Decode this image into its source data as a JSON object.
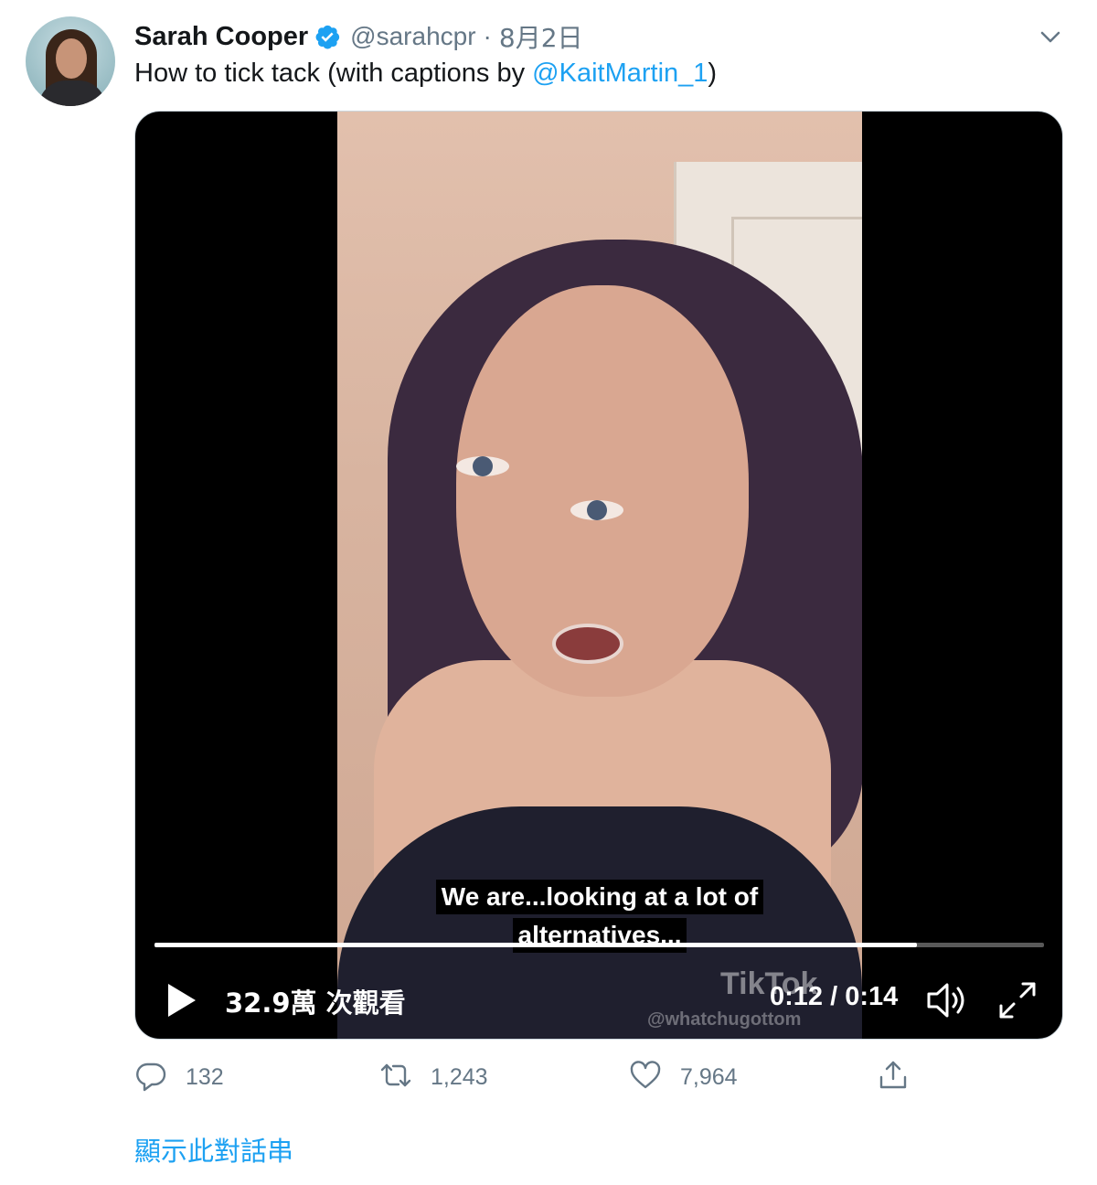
{
  "author": {
    "name": "Sarah Cooper",
    "handle": "@sarahcpr",
    "separator": "·",
    "date": "8月2日"
  },
  "tweet": {
    "text_before": "How to tick tack (with captions by ",
    "mention": "@KaitMartin_1",
    "text_after": ")"
  },
  "video": {
    "caption_line1": "We are...looking at a lot of",
    "caption_line2": "alternatives...",
    "watermark_logo": "TikTok",
    "watermark_handle": "@whatchugottom",
    "views": "32.9萬 次觀看",
    "time": "0:12 / 0:14",
    "progress_fraction": 0.857
  },
  "actions": {
    "replies": "132",
    "retweets": "1,243",
    "likes": "7,964"
  },
  "thread_link": "顯示此對話串",
  "colors": {
    "accent": "#1da1f2",
    "secondary_text": "#657786",
    "primary_text": "#14171a"
  }
}
